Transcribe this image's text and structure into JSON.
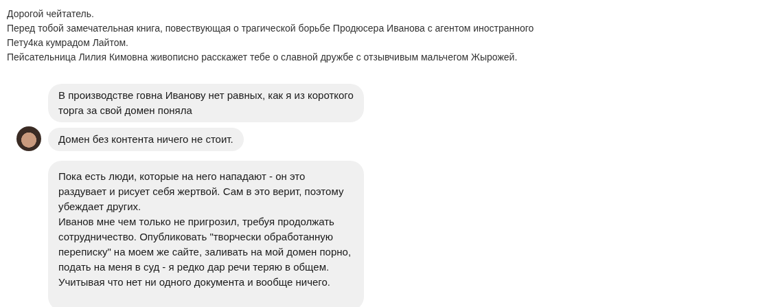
{
  "intro": [
    "Дорогой чейтатель.",
    "Перед тобой замечательная книга, повествующая о трагической борьбе Продюсера Иванова с агентом иностранного Пету4ка кумрадом Лайтом.",
    "Пейсательница Лилия Кимовна живописно расскажет тебе о славной дружбе с отзывчивым мальчегом Жырожей."
  ],
  "messages": [
    {
      "avatar": false,
      "paragraphs": [
        "В производстве говна Иванову нет равных, как я из короткого торга за свой домен поняла"
      ]
    },
    {
      "avatar": true,
      "paragraphs": [
        "Домен без контента ничего не стоит."
      ]
    },
    {
      "avatar": false,
      "paragraphs": [
        "Пока есть люди, которые на него нападают - он это раздувает и рисует себя жертвой. Сам в это верит, поэтому убеждает других.",
        "Иванов мне чем только не пригрозил, требуя продолжать сотрудничество. Опубликовать \"творчески обработанную переписку\" на моем же сайте, заливать на мой домен порно, подать на меня в суд - я редко дар речи теряю в общем. Учитывая что нет ни одного документа и вообще ничего."
      ]
    }
  ]
}
